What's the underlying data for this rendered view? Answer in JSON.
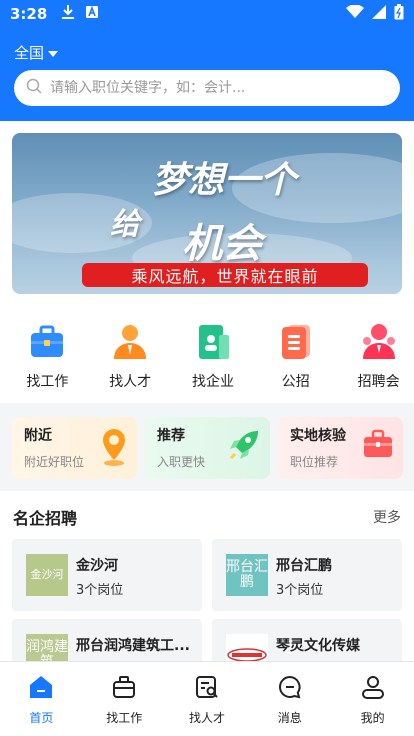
{
  "status_bar": {
    "time": "3:28"
  },
  "header": {
    "region": "全国",
    "search_placeholder": "请输入职位关键字，如：会计..."
  },
  "banner": {
    "slogan_line1": "梦想一个",
    "slogan_prefix": "给",
    "slogan_line2": "机会",
    "ribbon_text": "乘风远航，世界就在眼前"
  },
  "quick_nav": [
    {
      "label": "找工作",
      "icon": "briefcase-icon"
    },
    {
      "label": "找人才",
      "icon": "person-icon"
    },
    {
      "label": "找企业",
      "icon": "company-icon"
    },
    {
      "label": "公招",
      "icon": "document-icon"
    },
    {
      "label": "招聘会",
      "icon": "meeting-icon"
    }
  ],
  "feature_cards": [
    {
      "title": "附近",
      "subtitle": "附近好职位",
      "icon": "location-pin-icon"
    },
    {
      "title": "推荐",
      "subtitle": "入职更快",
      "icon": "rocket-icon"
    },
    {
      "title": "实地核验",
      "subtitle": "职位推荐",
      "icon": "suitcase-icon"
    }
  ],
  "famous_companies": {
    "title": "名企招聘",
    "more": "更多",
    "items": [
      {
        "name": "金沙河",
        "jobs": "3个岗位",
        "logo_text": "金沙河"
      },
      {
        "name": "邢台汇鹏",
        "jobs": "3个岗位",
        "logo_text": "邢台汇鹏"
      },
      {
        "name": "邢台润鸿建筑工...",
        "jobs": "",
        "logo_text": "润鸿建筑"
      },
      {
        "name": "琴灵文化传媒",
        "jobs": "",
        "logo_text": ""
      }
    ]
  },
  "tabbar": [
    {
      "label": "首页",
      "icon": "home-icon",
      "active": true
    },
    {
      "label": "找工作",
      "icon": "briefcase-icon",
      "active": false
    },
    {
      "label": "找人才",
      "icon": "find-talent-icon",
      "active": false
    },
    {
      "label": "消息",
      "icon": "message-icon",
      "active": false
    },
    {
      "label": "我的",
      "icon": "profile-icon",
      "active": false
    }
  ],
  "colors": {
    "brand": "#1677ff",
    "ribbon": "#e02020"
  }
}
